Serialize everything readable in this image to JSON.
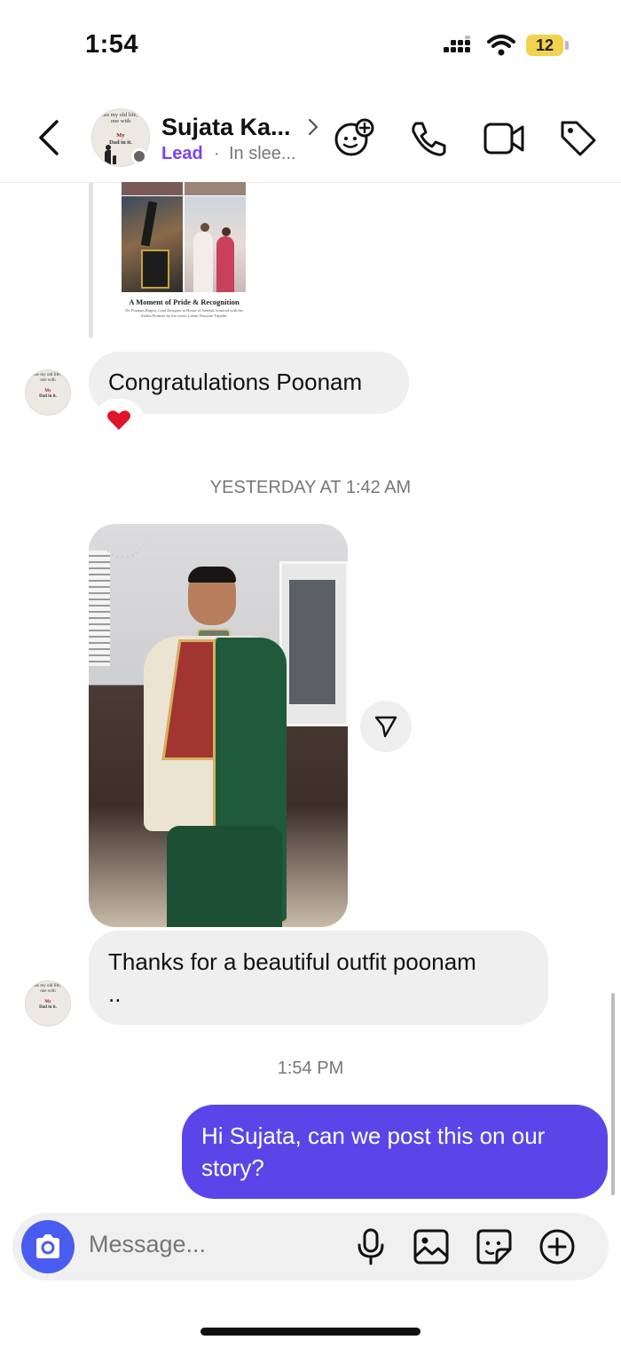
{
  "status_bar": {
    "time": "1:54",
    "battery": "12"
  },
  "header": {
    "contact_name": "Sujata Ka...",
    "label": "Lead",
    "separator": "·",
    "status": "In slee...",
    "avatar_text_top": "I miss my old life, the one with",
    "avatar_text_accent": "My",
    "avatar_text_bottom": "Dad in it.",
    "icons": [
      "back-icon",
      "chevron-right-icon",
      "add-avatar-icon",
      "phone-icon",
      "video-icon",
      "tag-icon"
    ]
  },
  "shared_post": {
    "caption": "A Moment of Pride & Recognition",
    "subcaption": "Dr. Poonam Rajput, Lead Designer at House of Sambal, honored with the Asthra Promise by the iconic Laxmi Narayan Tripathi."
  },
  "messages": [
    {
      "side": "incoming",
      "text": "Congratulations Poonam",
      "reaction": "❤️"
    },
    {
      "type": "timestamp",
      "text": "YESTERDAY AT 1:42 AM"
    },
    {
      "side": "incoming",
      "type": "photo"
    },
    {
      "side": "incoming",
      "text": "Thanks for a beautiful outfit poonam",
      "text2": ".."
    },
    {
      "type": "timestamp",
      "text": "1:54 PM"
    },
    {
      "side": "outgoing",
      "text": "Hi Sujata, can we post this on our",
      "text2": "story?"
    }
  ],
  "composer": {
    "placeholder": "Message...",
    "icons": [
      "camera-icon",
      "microphone-icon",
      "gallery-icon",
      "sticker-icon",
      "plus-icon"
    ]
  },
  "colors": {
    "accent": "#5a46e8",
    "lead": "#7b42f5",
    "camera_button": "#4a5cf0",
    "bubble_in": "#efefef"
  }
}
